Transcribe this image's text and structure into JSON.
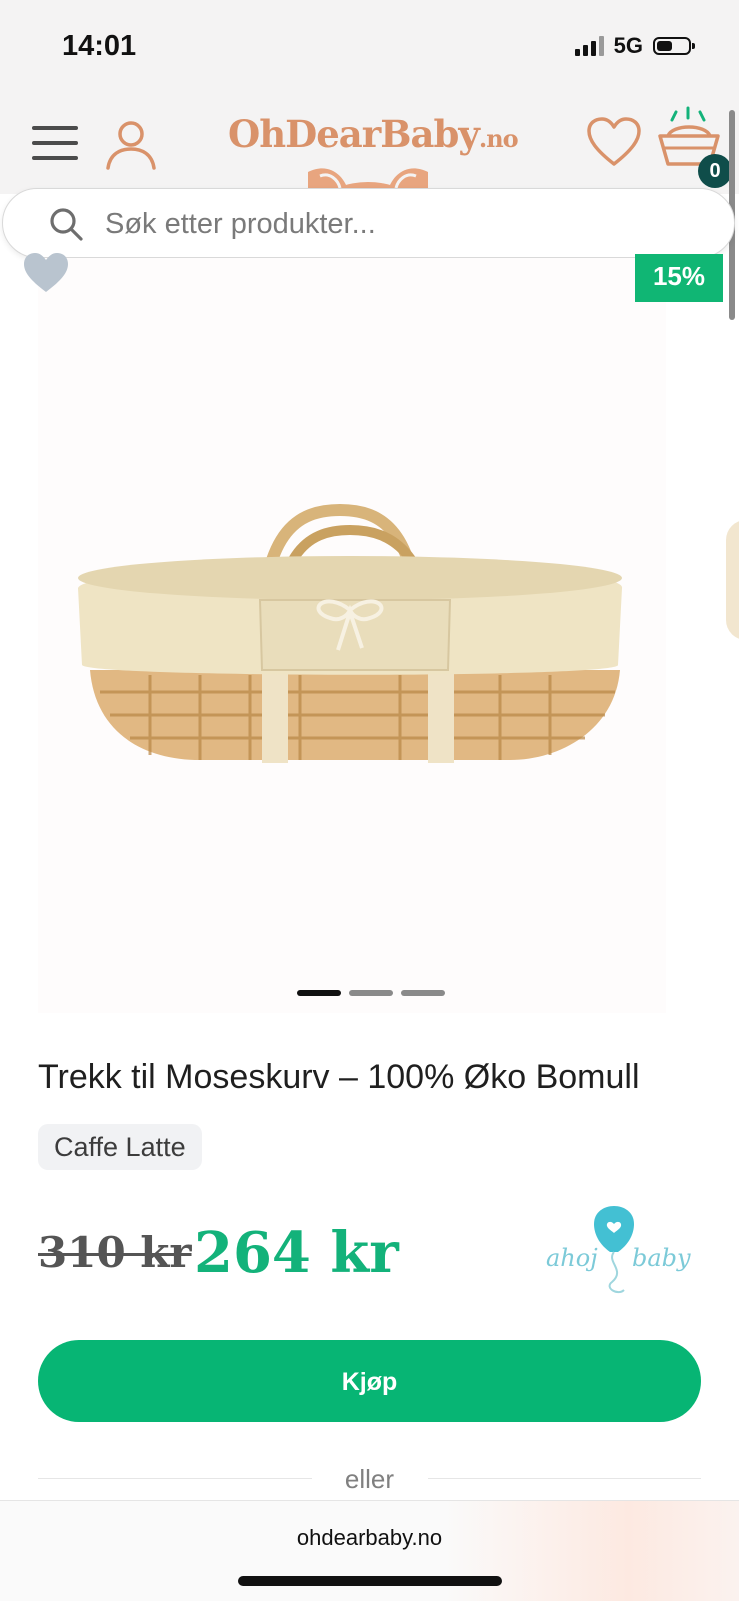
{
  "status_bar": {
    "time": "14:01",
    "network": "5G"
  },
  "header": {
    "logo_main": "OhDearBaby",
    "logo_suffix": ".no",
    "cart_count": "0",
    "icons": [
      "menu-icon",
      "account-icon",
      "heart-icon",
      "cart-icon"
    ]
  },
  "search": {
    "placeholder": "Søk etter produkter..."
  },
  "gallery": {
    "discount": "15%",
    "slide_count": 3,
    "active_slide": 1
  },
  "product": {
    "title": "Trekk til Moseskurv – 100% Øko Bomull",
    "variant": "Caffe Latte",
    "old_price": "310 kr",
    "price": "264 kr",
    "brand_logo_text": "ahoj baby"
  },
  "actions": {
    "buy_label": "Kjøp",
    "or_label": "eller"
  },
  "browser": {
    "url": "ohdearbaby.no"
  },
  "colors": {
    "accent": "#07b574",
    "price": "#13b27a",
    "logo": "#d9926a",
    "badge": "#10b674",
    "cart_badge": "#0f4d4a"
  }
}
